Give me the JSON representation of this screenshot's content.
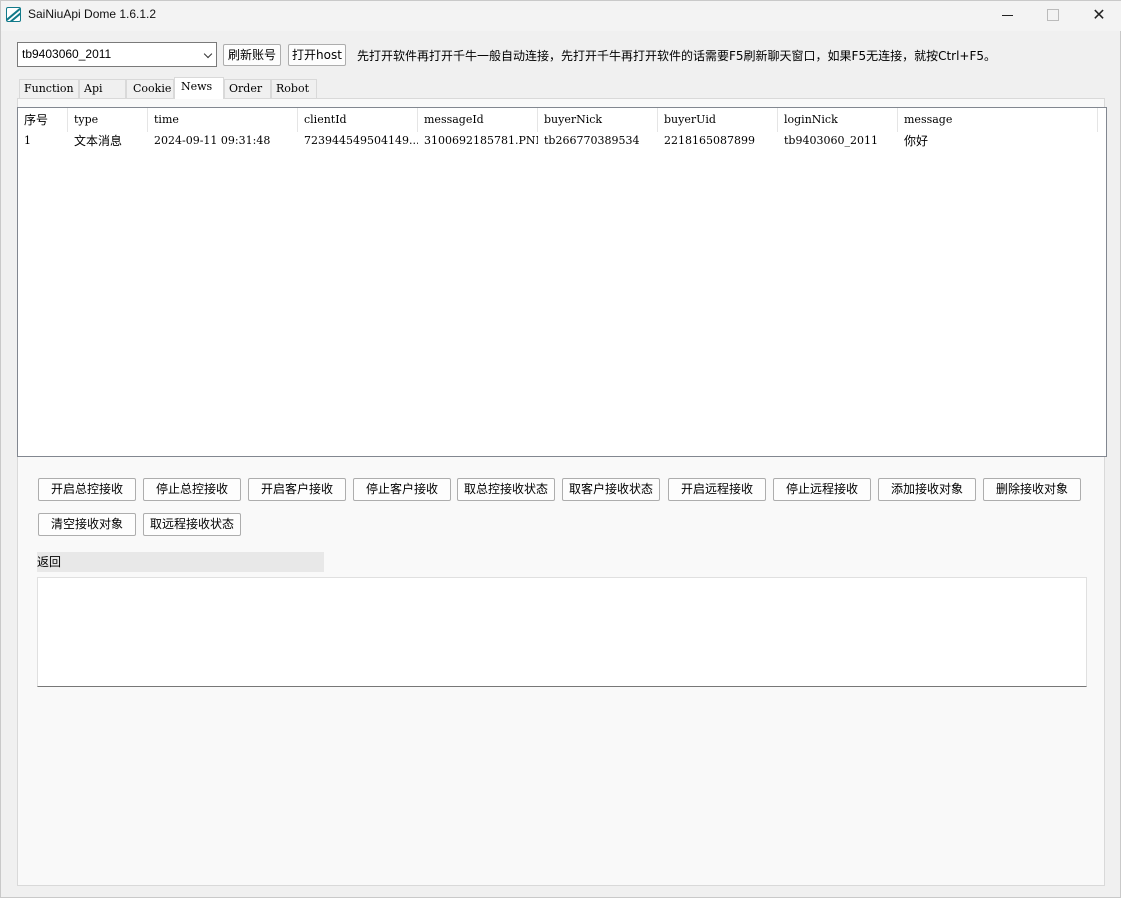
{
  "window": {
    "title": "SaiNiuApi Dome 1.6.1.2"
  },
  "toolbar": {
    "account_value": "tb9403060_2011",
    "refresh_account_label": "刷新账号",
    "open_host_label": "打开host",
    "hint": "先打开软件再打开千牛一般自动连接，先打开千牛再打开软件的话需要F5刷新聊天窗口，如果F5无连接，就按Ctrl+F5。"
  },
  "tabs": [
    {
      "label": "Function"
    },
    {
      "label": "Api"
    },
    {
      "label": "Cookie"
    },
    {
      "label": "News"
    },
    {
      "label": "Order"
    },
    {
      "label": "Robot"
    }
  ],
  "active_tab": "News",
  "list": {
    "columns": [
      "序号",
      "type",
      "time",
      "clientId",
      "messageId",
      "buyerNick",
      "buyerUid",
      "loginNick",
      "message"
    ],
    "rows": [
      [
        "1",
        "文本消息",
        "2024-09-11 09:31:48",
        "723944549504149...",
        "3100692185781.PNM",
        "tb266770389534",
        "2218165087899",
        "tb9403060_2011",
        "你好"
      ]
    ]
  },
  "actions": [
    "开启总控接收",
    "停止总控接收",
    "开启客户接收",
    "停止客户接收",
    "取总控接收状态",
    "取客户接收状态",
    "开启远程接收",
    "停止远程接收",
    "添加接收对象",
    "删除接收对象",
    "清空接收对象",
    "取远程接收状态"
  ],
  "return_section": {
    "label": "返回",
    "value": ""
  }
}
